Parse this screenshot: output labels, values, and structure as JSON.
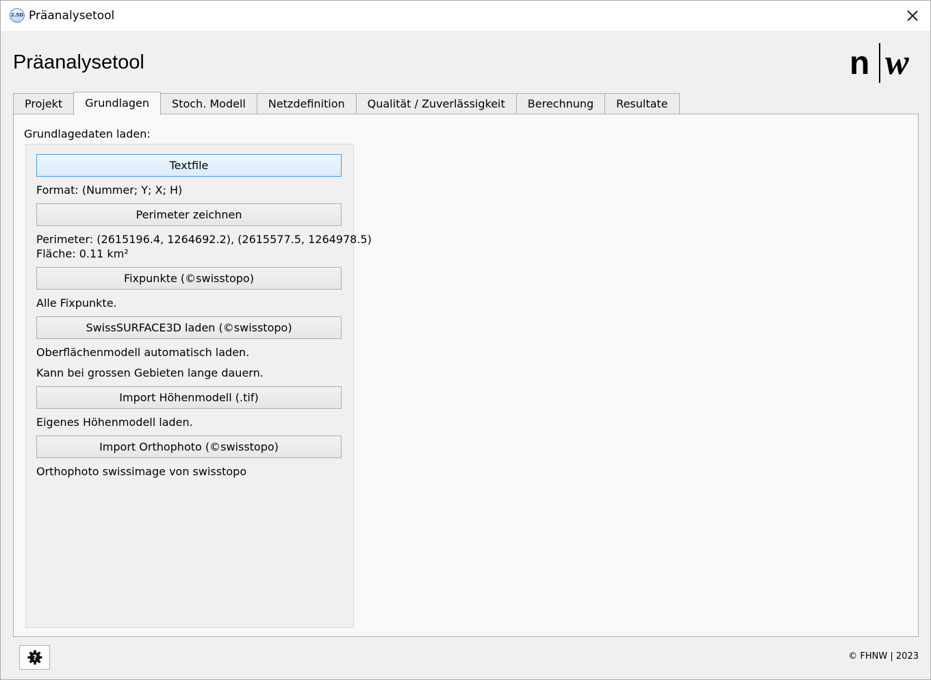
{
  "window": {
    "title": "Präanalysetool",
    "icon_label": "2.5D",
    "close_icon": "close-icon"
  },
  "header": {
    "heading": "Präanalysetool",
    "logo": {
      "left": "n",
      "right": "w"
    }
  },
  "tabs": [
    {
      "label": "Projekt",
      "active": false
    },
    {
      "label": "Grundlagen",
      "active": true
    },
    {
      "label": "Stoch. Modell",
      "active": false
    },
    {
      "label": "Netzdefinition",
      "active": false
    },
    {
      "label": "Qualität / Zuverlässigkeit",
      "active": false
    },
    {
      "label": "Berechnung",
      "active": false
    },
    {
      "label": "Resultate",
      "active": false
    }
  ],
  "grundlagen": {
    "section_label": "Grundlagedaten laden:",
    "textfile_button": "Textfile",
    "format_text": "Format: (Nummer; Y; X; H)",
    "perimeter_button": "Perimeter zeichnen",
    "perimeter_text": "Perimeter: (2615196.4, 1264692.2), (2615577.5, 1264978.5)",
    "area_text": "Fläche: 0.11 km²",
    "fixpunkte_button": "Fixpunkte (©swisstopo)",
    "fixpunkte_text": "Alle Fixpunkte.",
    "surface_button": "SwissSURFACE3D laden (©swisstopo)",
    "surface_text_1": "Oberflächenmodell automatisch laden.",
    "surface_text_2": "Kann bei grossen Gebieten lange dauern.",
    "hoehenmodell_button": "Import Höhenmodell (.tif)",
    "hoehenmodell_text": "Eigenes Höhenmodell laden.",
    "orthophoto_button": "Import Orthophoto (©swisstopo)",
    "orthophoto_text": "Orthophoto swissimage von swisstopo"
  },
  "footer": {
    "settings_icon": "gear-help-icon",
    "copyright": "© FHNW | 2023"
  }
}
